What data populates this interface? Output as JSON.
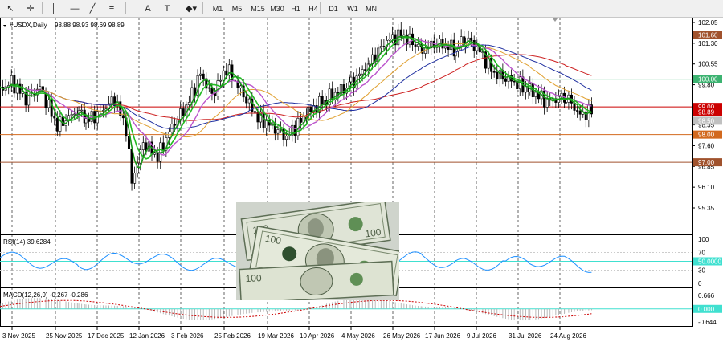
{
  "toolbar": {
    "tools": [
      {
        "name": "cursor-icon",
        "glyph": "↖"
      },
      {
        "name": "crosshair-icon",
        "glyph": "✛"
      },
      {
        "name": "vertical-line-icon",
        "glyph": "│"
      },
      {
        "name": "horizontal-line-icon",
        "glyph": "—"
      },
      {
        "name": "trendline-icon",
        "glyph": "╱"
      },
      {
        "name": "fibonacci-icon",
        "glyph": "≡"
      },
      {
        "name": "text-icon",
        "glyph": "A"
      },
      {
        "name": "text-label-icon",
        "glyph": "T"
      },
      {
        "name": "shapes-dropdown-icon",
        "glyph": "◆▾"
      }
    ],
    "timeframes": [
      "M1",
      "M5",
      "M15",
      "M30",
      "H1",
      "H4",
      "D1",
      "W1",
      "MN"
    ]
  },
  "chart_info": {
    "title": "#USDX,Daily",
    "ohlc": "98.88 98.93 98.69 98.89"
  },
  "price_axis": {
    "ticks": [
      "102.05",
      "101.30",
      "100.55",
      "99.80",
      "98.35",
      "97.60",
      "96.85",
      "96.10",
      "95.35"
    ],
    "boxes": [
      {
        "label": "101.60",
        "color": "#a0522d"
      },
      {
        "label": "100.00",
        "color": "#3cb371"
      },
      {
        "label": "99.00",
        "color": "#cc0000"
      },
      {
        "label": "98.89",
        "color": "#cc0000"
      },
      {
        "label": "98.50",
        "color": "#c0c0c0"
      },
      {
        "label": "98.00",
        "color": "#d2691e"
      },
      {
        "label": "97.00",
        "color": "#a0522d"
      }
    ]
  },
  "rsi": {
    "label": "RSI(14) 39.6284",
    "ticks": [
      "100",
      "70",
      "50.0000",
      "30",
      "0"
    ]
  },
  "macd": {
    "label": "MACD(12,26,9) -0.267 -0.286",
    "ticks": [
      "0.666",
      "0.000",
      "-0.644"
    ]
  },
  "time_axis": {
    "labels": [
      "3 Nov 2025",
      "25 Nov 2025",
      "17 Dec 2025",
      "12 Jan 2026",
      "3 Feb 2026",
      "25 Feb 2026",
      "19 Mar 2026",
      "10 Apr 2026",
      "4 May 2026",
      "26 May 2026",
      "17 Jun 2026",
      "9 Jul 2026",
      "31 Jul 2026",
      "24 Aug 2026"
    ]
  },
  "colors": {
    "ma_fast": "#1a9a1a",
    "ma_medium": "#22bb22",
    "ma_slow": "#bb55cc",
    "ma_50": "#e0a030",
    "ma_100": "#2030a0",
    "ma_200": "#cc2020",
    "rsi_line": "#1e90ff",
    "macd_hist": "#b0b0b0",
    "macd_signal": "#cc0000"
  }
}
